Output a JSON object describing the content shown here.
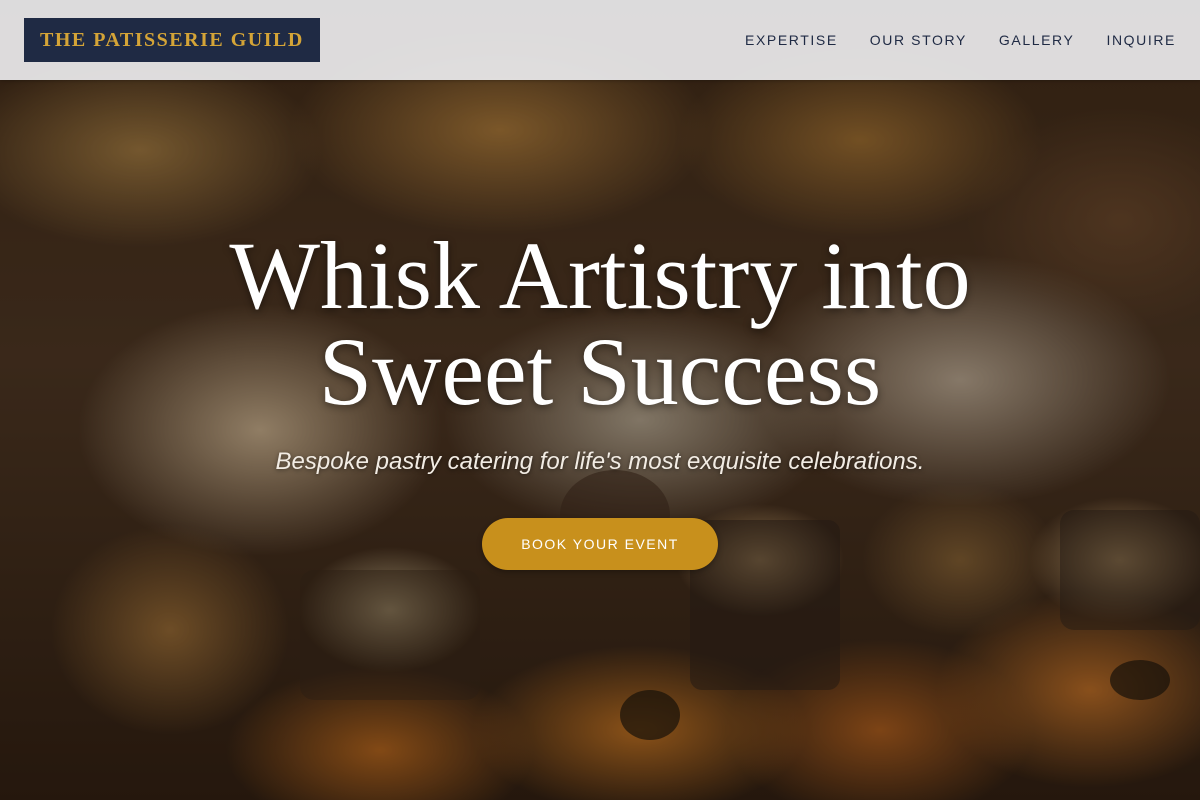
{
  "header": {
    "logo_text": "THE PATISSERIE GUILD",
    "nav": [
      {
        "label": "EXPERTISE"
      },
      {
        "label": "OUR STORY"
      },
      {
        "label": "GALLERY"
      },
      {
        "label": "INQUIRE"
      }
    ]
  },
  "hero": {
    "headline_line1": "Whisk Artistry into",
    "headline_line2": "Sweet Success",
    "tagline": "Bespoke pastry catering for life's most exquisite celebrations.",
    "cta_label": "BOOK YOUR EVENT"
  },
  "colors": {
    "logo_bg": "#1f2a44",
    "logo_text": "#d4a437",
    "nav_text": "#1f2a44",
    "cta_bg": "#c8901c",
    "header_bg": "#ececee"
  }
}
